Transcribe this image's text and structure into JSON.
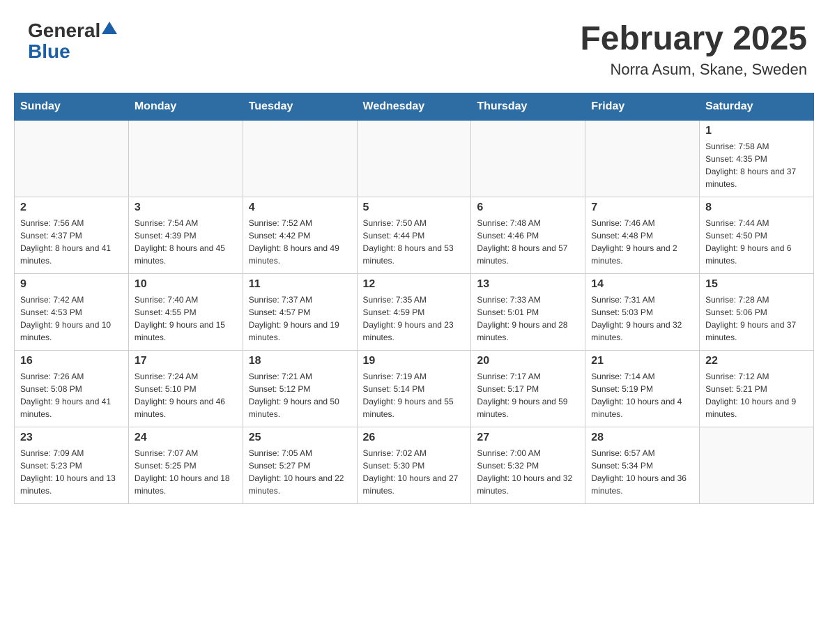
{
  "header": {
    "logo_general": "General",
    "logo_blue": "Blue",
    "title": "February 2025",
    "subtitle": "Norra Asum, Skane, Sweden"
  },
  "days_of_week": [
    "Sunday",
    "Monday",
    "Tuesday",
    "Wednesday",
    "Thursday",
    "Friday",
    "Saturday"
  ],
  "weeks": [
    [
      {
        "day": "",
        "info": ""
      },
      {
        "day": "",
        "info": ""
      },
      {
        "day": "",
        "info": ""
      },
      {
        "day": "",
        "info": ""
      },
      {
        "day": "",
        "info": ""
      },
      {
        "day": "",
        "info": ""
      },
      {
        "day": "1",
        "info": "Sunrise: 7:58 AM\nSunset: 4:35 PM\nDaylight: 8 hours and 37 minutes."
      }
    ],
    [
      {
        "day": "2",
        "info": "Sunrise: 7:56 AM\nSunset: 4:37 PM\nDaylight: 8 hours and 41 minutes."
      },
      {
        "day": "3",
        "info": "Sunrise: 7:54 AM\nSunset: 4:39 PM\nDaylight: 8 hours and 45 minutes."
      },
      {
        "day": "4",
        "info": "Sunrise: 7:52 AM\nSunset: 4:42 PM\nDaylight: 8 hours and 49 minutes."
      },
      {
        "day": "5",
        "info": "Sunrise: 7:50 AM\nSunset: 4:44 PM\nDaylight: 8 hours and 53 minutes."
      },
      {
        "day": "6",
        "info": "Sunrise: 7:48 AM\nSunset: 4:46 PM\nDaylight: 8 hours and 57 minutes."
      },
      {
        "day": "7",
        "info": "Sunrise: 7:46 AM\nSunset: 4:48 PM\nDaylight: 9 hours and 2 minutes."
      },
      {
        "day": "8",
        "info": "Sunrise: 7:44 AM\nSunset: 4:50 PM\nDaylight: 9 hours and 6 minutes."
      }
    ],
    [
      {
        "day": "9",
        "info": "Sunrise: 7:42 AM\nSunset: 4:53 PM\nDaylight: 9 hours and 10 minutes."
      },
      {
        "day": "10",
        "info": "Sunrise: 7:40 AM\nSunset: 4:55 PM\nDaylight: 9 hours and 15 minutes."
      },
      {
        "day": "11",
        "info": "Sunrise: 7:37 AM\nSunset: 4:57 PM\nDaylight: 9 hours and 19 minutes."
      },
      {
        "day": "12",
        "info": "Sunrise: 7:35 AM\nSunset: 4:59 PM\nDaylight: 9 hours and 23 minutes."
      },
      {
        "day": "13",
        "info": "Sunrise: 7:33 AM\nSunset: 5:01 PM\nDaylight: 9 hours and 28 minutes."
      },
      {
        "day": "14",
        "info": "Sunrise: 7:31 AM\nSunset: 5:03 PM\nDaylight: 9 hours and 32 minutes."
      },
      {
        "day": "15",
        "info": "Sunrise: 7:28 AM\nSunset: 5:06 PM\nDaylight: 9 hours and 37 minutes."
      }
    ],
    [
      {
        "day": "16",
        "info": "Sunrise: 7:26 AM\nSunset: 5:08 PM\nDaylight: 9 hours and 41 minutes."
      },
      {
        "day": "17",
        "info": "Sunrise: 7:24 AM\nSunset: 5:10 PM\nDaylight: 9 hours and 46 minutes."
      },
      {
        "day": "18",
        "info": "Sunrise: 7:21 AM\nSunset: 5:12 PM\nDaylight: 9 hours and 50 minutes."
      },
      {
        "day": "19",
        "info": "Sunrise: 7:19 AM\nSunset: 5:14 PM\nDaylight: 9 hours and 55 minutes."
      },
      {
        "day": "20",
        "info": "Sunrise: 7:17 AM\nSunset: 5:17 PM\nDaylight: 9 hours and 59 minutes."
      },
      {
        "day": "21",
        "info": "Sunrise: 7:14 AM\nSunset: 5:19 PM\nDaylight: 10 hours and 4 minutes."
      },
      {
        "day": "22",
        "info": "Sunrise: 7:12 AM\nSunset: 5:21 PM\nDaylight: 10 hours and 9 minutes."
      }
    ],
    [
      {
        "day": "23",
        "info": "Sunrise: 7:09 AM\nSunset: 5:23 PM\nDaylight: 10 hours and 13 minutes."
      },
      {
        "day": "24",
        "info": "Sunrise: 7:07 AM\nSunset: 5:25 PM\nDaylight: 10 hours and 18 minutes."
      },
      {
        "day": "25",
        "info": "Sunrise: 7:05 AM\nSunset: 5:27 PM\nDaylight: 10 hours and 22 minutes."
      },
      {
        "day": "26",
        "info": "Sunrise: 7:02 AM\nSunset: 5:30 PM\nDaylight: 10 hours and 27 minutes."
      },
      {
        "day": "27",
        "info": "Sunrise: 7:00 AM\nSunset: 5:32 PM\nDaylight: 10 hours and 32 minutes."
      },
      {
        "day": "28",
        "info": "Sunrise: 6:57 AM\nSunset: 5:34 PM\nDaylight: 10 hours and 36 minutes."
      },
      {
        "day": "",
        "info": ""
      }
    ]
  ]
}
